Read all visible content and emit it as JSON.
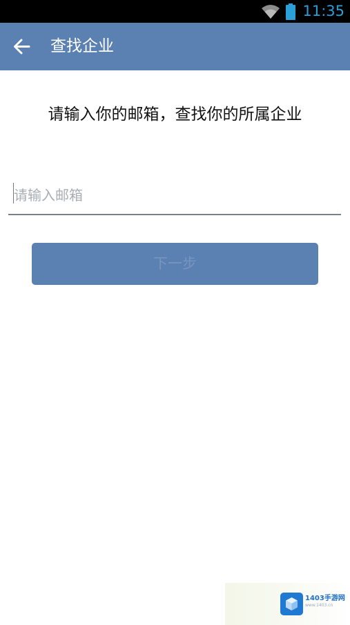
{
  "status_bar": {
    "time": "11:35",
    "wifi_icon": "wifi-icon",
    "battery_icon": "battery-icon",
    "time_color": "#2b9fd8"
  },
  "app_bar": {
    "title": "查找企业",
    "back_icon": "back-arrow-icon",
    "background": "#5b80b2"
  },
  "main": {
    "instruction": "请输入你的邮箱，查找你的所属企业",
    "email_input": {
      "value": "",
      "placeholder": "请输入邮箱"
    },
    "next_button_label": "下一步"
  },
  "watermark": {
    "brand": "1403手游网",
    "site": "www.1403.cn",
    "logo_icon": "cube-logo-icon"
  },
  "colors": {
    "accent": "#5b80b2",
    "text": "#111111",
    "placeholder": "#a9aeb4"
  }
}
